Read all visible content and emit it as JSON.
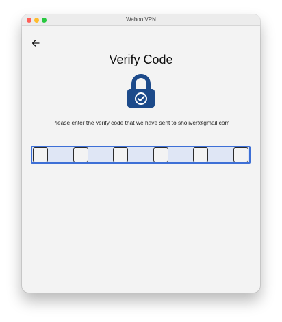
{
  "window": {
    "title": "Wahoo VPN"
  },
  "screen": {
    "back_icon": "arrow-left-icon",
    "title": "Verify Code",
    "lock_icon": "lock-check-icon",
    "instruction": "Please enter the verify code that we have sent to sholiver@gmail.com"
  },
  "code_inputs": [
    "",
    "",
    "",
    "",
    "",
    ""
  ],
  "colors": {
    "lock_blue": "#1c4a8a",
    "focus_border": "#3d6fd6",
    "focus_fill": "#dfe6f5",
    "window_bg": "#f3f3f3"
  }
}
